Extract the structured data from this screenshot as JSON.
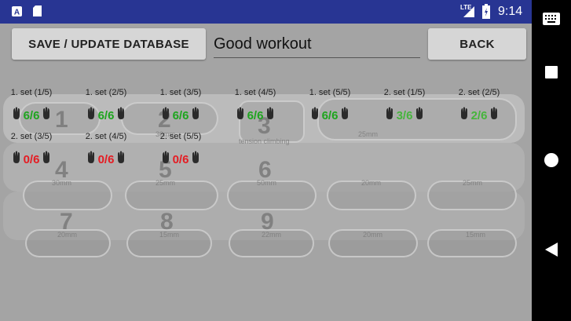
{
  "status_bar": {
    "time": "9:14",
    "network": "LTE",
    "icons": [
      "a-notification-icon",
      "sd-card-icon",
      "signal-icon",
      "battery-icon"
    ]
  },
  "toolbar": {
    "save_label": "SAVE / UPDATE DATABASE",
    "comment_value": "Good workout",
    "back_label": "BACK"
  },
  "board": {
    "holds": [
      {
        "num": "1",
        "size": ""
      },
      {
        "num": "2",
        "size": "30mm"
      },
      {
        "num": "3",
        "size": "tension climbing"
      },
      {
        "num": "",
        "size": "25mm"
      },
      {
        "num": "4",
        "size": "30mm"
      },
      {
        "num": "5",
        "size": "25mm"
      },
      {
        "num": "6",
        "size": "50mm"
      },
      {
        "num": "",
        "size": "20mm"
      },
      {
        "num": "",
        "size": "25mm"
      },
      {
        "num": "7",
        "size": "20mm"
      },
      {
        "num": "8",
        "size": "15mm"
      },
      {
        "num": "9",
        "size": "22mm"
      },
      {
        "num": "",
        "size": "20mm"
      },
      {
        "num": "",
        "size": "15mm"
      }
    ]
  },
  "sets": [
    {
      "label": "1. set (1/5)",
      "count": "6/6",
      "status": "success"
    },
    {
      "label": "1. set (2/5)",
      "count": "6/6",
      "status": "success"
    },
    {
      "label": "1. set (3/5)",
      "count": "6/6",
      "status": "success"
    },
    {
      "label": "1. set (4/5)",
      "count": "6/6",
      "status": "success"
    },
    {
      "label": "1. set (5/5)",
      "count": "6/6",
      "status": "success"
    },
    {
      "label": "2. set (1/5)",
      "count": "3/6",
      "status": "partial"
    },
    {
      "label": "2. set (2/5)",
      "count": "2/6",
      "status": "partial"
    },
    {
      "label": "2. set (3/5)",
      "count": "0/6",
      "status": "fail"
    },
    {
      "label": "2. set (4/5)",
      "count": "0/6",
      "status": "fail"
    },
    {
      "label": "2. set (5/5)",
      "count": "0/6",
      "status": "fail"
    }
  ],
  "colors": {
    "success": "#1ea51e",
    "partial": "#46b53c",
    "fail": "#e51c23",
    "status_bar": "#283593"
  },
  "nav": {
    "icons": [
      "keyboard-icon",
      "recents-icon",
      "home-icon",
      "back-icon"
    ]
  }
}
